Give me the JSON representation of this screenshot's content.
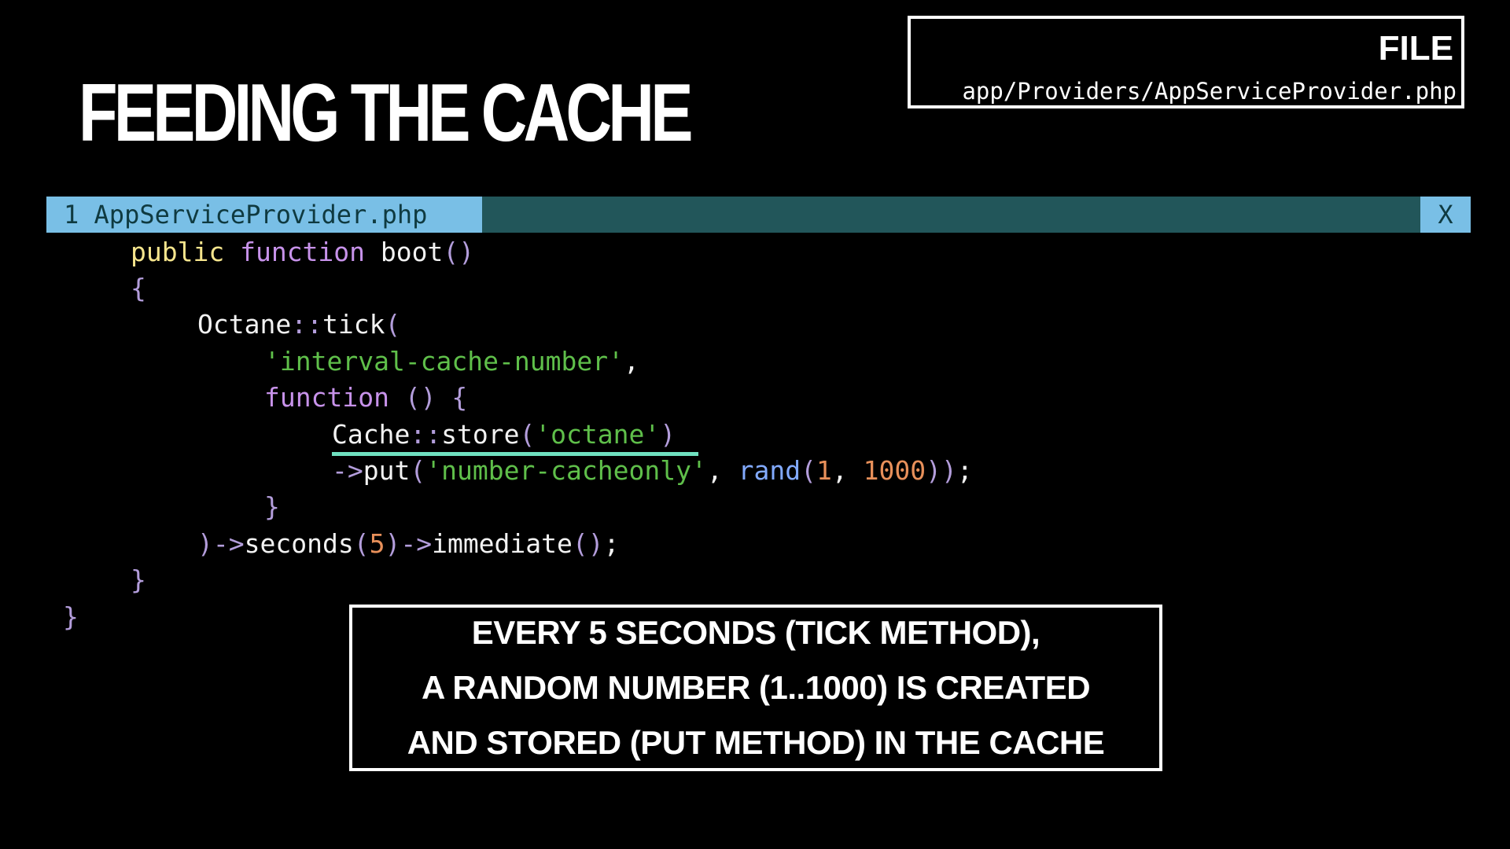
{
  "slide": {
    "title": "FEEDING THE CACHE"
  },
  "file_box": {
    "label": "FILE",
    "path": "app/Providers/AppServiceProvider.php"
  },
  "editor": {
    "tab_label": "1 AppServiceProvider.php",
    "close_label": "X",
    "colors": {
      "tab_active_bg": "#79bfe6",
      "tabbar_bg": "#22565a",
      "keyword": "#c792ea",
      "string": "#5fbf4a",
      "number": "#e8905a",
      "function_call": "#82aaff",
      "highlight_underline": "#6fe0c0"
    },
    "code": {
      "l1": {
        "public": "public",
        "space": " ",
        "function": "function",
        "rest": " boot",
        "paren": "()"
      },
      "l2": {
        "brace": "{"
      },
      "l3": {
        "cls": "Octane",
        "sep": "::",
        "method": "tick",
        "paren": "("
      },
      "l4": {
        "string": "'interval-cache-number'",
        "comma": ","
      },
      "l5": {
        "function": "function",
        "parens": " () {"
      },
      "l6": {
        "cls": "Cache",
        "sep": "::",
        "method": "store",
        "open": "(",
        "string": "'octane'",
        "close": ")"
      },
      "l7": {
        "arrow": "->",
        "method": "put",
        "open": "(",
        "string": "'number-cacheonly'",
        "comma": ", ",
        "rand": "rand",
        "ropen": "(",
        "n1": "1",
        "c2": ", ",
        "n2": "1000",
        "close": "))",
        "semi": ";"
      },
      "l8": {
        "brace": "}"
      },
      "l9": {
        "close": ")",
        "arrow1": "->",
        "m1": "seconds",
        "open1": "(",
        "n": "5",
        "close1": ")",
        "arrow2": "->",
        "m2": "immediate",
        "paren2": "()",
        "semi": ";"
      },
      "l10": {
        "brace": "}"
      },
      "l11": {
        "brace": "}"
      }
    }
  },
  "caption": {
    "lines": [
      "EVERY 5 SECONDS (TICK METHOD),",
      "A RANDOM NUMBER (1..1000) IS CREATED",
      "AND STORED (PUT METHOD) IN THE CACHE"
    ]
  }
}
